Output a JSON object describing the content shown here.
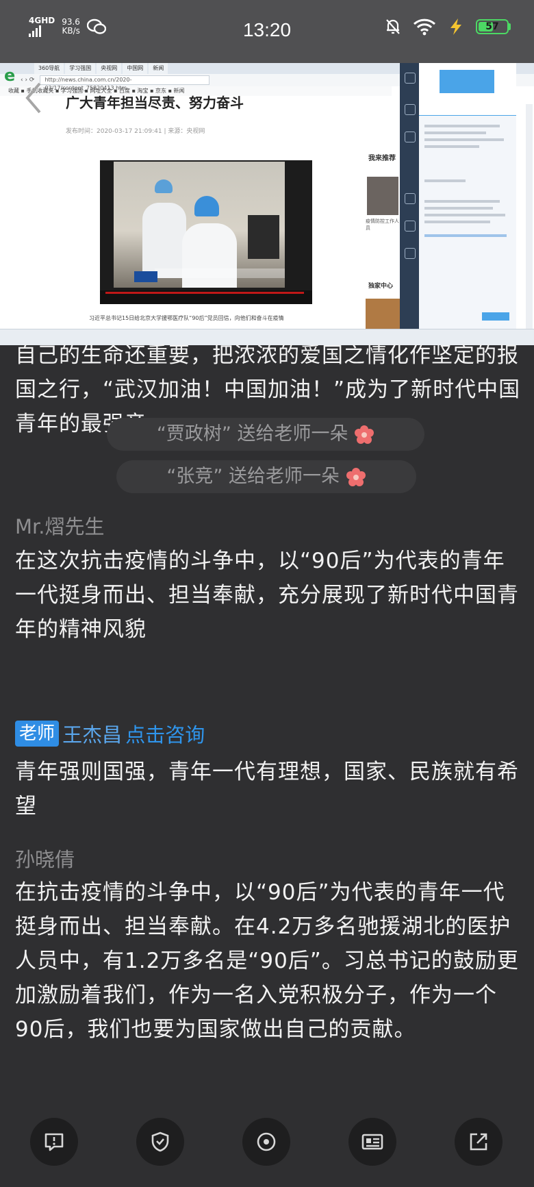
{
  "status_bar": {
    "network": "4GHD",
    "speed_value": "93.6",
    "speed_unit": "KB/s",
    "time": "13:20",
    "battery": "57",
    "battery_level": 0.57
  },
  "video": {
    "article_title": "广大青年担当尽责、努力奋斗",
    "article_meta": "发布时间：2020-03-17 21:09:41 | 来源：央视网",
    "caption": "习近平总书记15日给北京大学援鄂医疗队“90后”党员回信，向他们和奋斗在疫情",
    "address": "http://news.china.com.cn/2020-03/17/content_75820413.htm",
    "recommend_1": "我来推荐",
    "recommend_1_text": "疫情防控工作人员",
    "recommend_2": "独家中心"
  },
  "chat": {
    "intro_text": "自己的生命还重要，把浓浓的爱国之情化作坚定的报国之行，“武汉加油！中国加油！”成为了新时代中国青年的最强音。",
    "gifts": [
      {
        "text": "“贾政树” 送给老师一朵"
      },
      {
        "text": "“张竞” 送给老师一朵"
      }
    ],
    "messages": [
      {
        "sender": "Mr.熠先生",
        "text": "在这次抗击疫情的斗争中，以“90后”为代表的青年一代挺身而出、担当奉献，充分展现了新时代中国青年的精神风貌"
      },
      {
        "badge": "老师",
        "sender": "王杰昌",
        "consult": "点击咨询",
        "text": "青年强则国强，青年一代有理想，国家、民族就有希望"
      },
      {
        "sender": "孙晓倩",
        "text": "在抗击疫情的斗争中，以“90后”为代表的青年一代挺身而出、担当奉献。在4.2万多名驰援湖北的医护人员中，有1.2万多名是“90后”。习总书记的鼓励更加激励着我们，作为一名入党积极分子，作为一个90后，我们也要为国家做出自己的贡献。"
      }
    ]
  },
  "toolbar": {
    "icons": [
      "chat-bubble-icon",
      "shield-icon",
      "eye-icon",
      "id-card-icon",
      "share-icon"
    ]
  },
  "colors": {
    "background": "#2f2f31",
    "status_bar": "#505052",
    "teacher_badge": "#2f8de4",
    "consult_link": "#2f95ec",
    "battery": "#4cd964"
  }
}
